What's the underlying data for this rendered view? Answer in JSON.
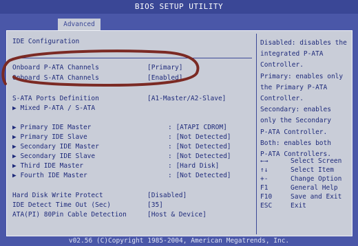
{
  "window": {
    "title": "BIOS SETUP UTILITY"
  },
  "tabs": [
    {
      "label": "Advanced"
    }
  ],
  "section": {
    "title": "IDE Configuration"
  },
  "settings": [
    {
      "label": "Onboard P-ATA Channels",
      "value": "[Primary]"
    },
    {
      "label": "Onboard S-ATA Channels",
      "value": "[Enabled]"
    },
    {
      "label": "S-ATA Ports Definition",
      "value": "[A1-Master/A2-Slave]"
    },
    {
      "label": "▶ Mixed P-ATA / S-ATA",
      "value": ""
    },
    {
      "label": "▶ Primary IDE Master",
      "value": ": [ATAPI CDROM]"
    },
    {
      "label": "▶ Primary IDE Slave",
      "value": ": [Not Detected]"
    },
    {
      "label": "▶ Secondary IDE Master",
      "value": ": [Not Detected]"
    },
    {
      "label": "▶ Secondary IDE Slave",
      "value": ": [Not Detected]"
    },
    {
      "label": "▶ Third IDE Master",
      "value": ": [Hard Disk]"
    },
    {
      "label": "▶ Fourth IDE Master",
      "value": ": [Not Detected]"
    },
    {
      "label": "Hard Disk Write Protect",
      "value": "[Disabled]"
    },
    {
      "label": "IDE Detect Time Out (Sec)",
      "value": "[35]"
    },
    {
      "label": "ATA(PI) 80Pin Cable Detection",
      "value": "[Host & Device]"
    }
  ],
  "help": {
    "lines": [
      "Disabled: disables the",
      "integrated P-ATA",
      "Controller.",
      "Primary: enables only",
      "the Primary P-ATA",
      "Controller.",
      "Secondary: enables",
      "only the Secondary",
      "P-ATA Controller.",
      "Both: enables both",
      "P-ATA Controllers."
    ]
  },
  "keys": [
    {
      "key": "←→",
      "desc": "Select Screen"
    },
    {
      "key": "↑↓",
      "desc": "Select Item"
    },
    {
      "key": "+-",
      "desc": "Change Option"
    },
    {
      "key": "F1",
      "desc": "General Help"
    },
    {
      "key": "F10",
      "desc": "Save and Exit"
    },
    {
      "key": "ESC",
      "desc": "Exit"
    }
  ],
  "footer": {
    "text": "v02.56 (C)Copyright 1985-2004, American Megatrends, Inc."
  },
  "colors": {
    "background": "#4a57a8",
    "panel": "#c9cdd8",
    "text": "#1e2a7a",
    "annotation": "#7b2a24"
  }
}
